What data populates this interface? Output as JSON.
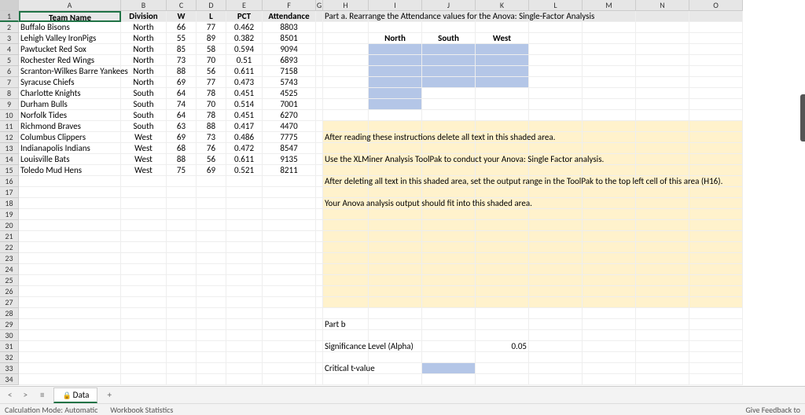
{
  "columns": [
    "A",
    "B",
    "C",
    "D",
    "E",
    "F",
    "G",
    "H",
    "I",
    "J",
    "K",
    "L",
    "M",
    "N",
    "O"
  ],
  "rows": [
    "1",
    "2",
    "3",
    "4",
    "5",
    "6",
    "7",
    "8",
    "9",
    "10",
    "11",
    "12",
    "13",
    "14",
    "15",
    "16",
    "17",
    "18",
    "19",
    "20",
    "21",
    "22",
    "23",
    "24",
    "25",
    "26",
    "27",
    "28",
    "29",
    "30",
    "31",
    "32",
    "33",
    "34"
  ],
  "header": {
    "A": "Team Name",
    "B": "Division",
    "C": "W",
    "D": "L",
    "E": "PCT",
    "F": "Attendance"
  },
  "data": [
    {
      "name": "Buffalo Bisons",
      "div": "North",
      "w": "66",
      "l": "77",
      "pct": "0.462",
      "att": "8803"
    },
    {
      "name": "Lehigh Valley IronPigs",
      "div": "North",
      "w": "55",
      "l": "89",
      "pct": "0.382",
      "att": "8501"
    },
    {
      "name": "Pawtucket Red Sox",
      "div": "North",
      "w": "85",
      "l": "58",
      "pct": "0.594",
      "att": "9094"
    },
    {
      "name": "Rochester Red Wings",
      "div": "North",
      "w": "73",
      "l": "70",
      "pct": "0.51",
      "att": "6893"
    },
    {
      "name": "Scranton-Wilkes Barre Yankees",
      "div": "North",
      "w": "88",
      "l": "56",
      "pct": "0.611",
      "att": "7158",
      "tall": true
    },
    {
      "name": "Syracuse Chiefs",
      "div": "North",
      "w": "69",
      "l": "77",
      "pct": "0.473",
      "att": "5743"
    },
    {
      "name": "Charlotte Knights",
      "div": "South",
      "w": "64",
      "l": "78",
      "pct": "0.451",
      "att": "4525"
    },
    {
      "name": "Durham Bulls",
      "div": "South",
      "w": "74",
      "l": "70",
      "pct": "0.514",
      "att": "7001"
    },
    {
      "name": "Norfolk Tides",
      "div": "South",
      "w": "64",
      "l": "78",
      "pct": "0.451",
      "att": "6270"
    },
    {
      "name": "Richmond Braves",
      "div": "South",
      "w": "63",
      "l": "88",
      "pct": "0.417",
      "att": "4470"
    },
    {
      "name": "Columbus Clippers",
      "div": "West",
      "w": "69",
      "l": "73",
      "pct": "0.486",
      "att": "7775"
    },
    {
      "name": "Indianapolis Indians",
      "div": "West",
      "w": "68",
      "l": "76",
      "pct": "0.472",
      "att": "8547"
    },
    {
      "name": "Louisville Bats",
      "div": "West",
      "w": "88",
      "l": "56",
      "pct": "0.611",
      "att": "9135"
    },
    {
      "name": "Toledo Mud Hens",
      "div": "West",
      "w": "75",
      "l": "69",
      "pct": "0.521",
      "att": "8211"
    }
  ],
  "right": {
    "parta": "Part a. Rearrange the Attendance values for the Anova: Single-Factor Analysis",
    "north": "North",
    "south": "South",
    "west": "West",
    "instr1": "After reading these instructions delete all text in this shaded area.",
    "instr2": "Use the XLMiner Analysis ToolPak to conduct your Anova: Single Factor analysis.",
    "instr3": "After deleting all text in this shaded area, set the output range in the ToolPak to the top left cell of this area (H16).",
    "instr4": "Your Anova analysis output should fit into this shaded area.",
    "partb": "Part b",
    "siglabel": "Significance Level (Alpha)",
    "sigval": "0.05",
    "critlabel": "Critical t-value"
  },
  "tabs": {
    "sheet": "Data"
  },
  "status": {
    "calc": "Calculation Mode: Automatic",
    "stats": "Workbook Statistics",
    "feedback": "Give Feedback to"
  },
  "chart_data": {
    "type": "table",
    "title": "Team Attendance Data for ANOVA",
    "columns": [
      "Team Name",
      "Division",
      "W",
      "L",
      "PCT",
      "Attendance"
    ],
    "rows": [
      [
        "Buffalo Bisons",
        "North",
        66,
        77,
        0.462,
        8803
      ],
      [
        "Lehigh Valley IronPigs",
        "North",
        55,
        89,
        0.382,
        8501
      ],
      [
        "Pawtucket Red Sox",
        "North",
        85,
        58,
        0.594,
        9094
      ],
      [
        "Rochester Red Wings",
        "North",
        73,
        70,
        0.51,
        6893
      ],
      [
        "Scranton-Wilkes Barre Yankees",
        "North",
        88,
        56,
        0.611,
        7158
      ],
      [
        "Syracuse Chiefs",
        "North",
        69,
        77,
        0.473,
        5743
      ],
      [
        "Charlotte Knights",
        "South",
        64,
        78,
        0.451,
        4525
      ],
      [
        "Durham Bulls",
        "South",
        74,
        70,
        0.514,
        7001
      ],
      [
        "Norfolk Tides",
        "South",
        64,
        78,
        0.451,
        6270
      ],
      [
        "Richmond Braves",
        "South",
        63,
        88,
        0.417,
        4470
      ],
      [
        "Columbus Clippers",
        "West",
        69,
        73,
        0.486,
        7775
      ],
      [
        "Indianapolis Indians",
        "West",
        68,
        76,
        0.472,
        8547
      ],
      [
        "Louisville Bats",
        "West",
        88,
        56,
        0.611,
        9135
      ],
      [
        "Toledo Mud Hens",
        "West",
        75,
        69,
        0.521,
        8211
      ]
    ],
    "alpha": 0.05
  }
}
